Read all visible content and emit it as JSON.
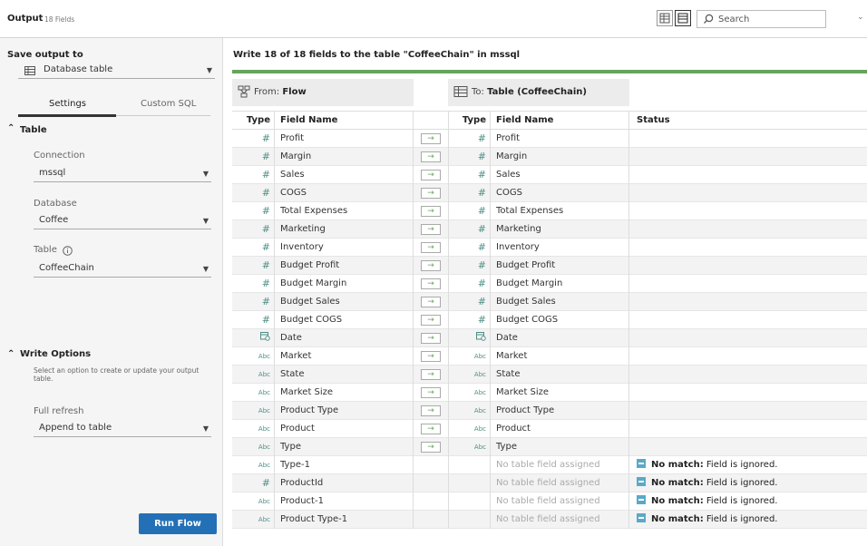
{
  "header": {
    "title": "Output",
    "field_count": "18 Fields",
    "search_placeholder": "Search"
  },
  "left": {
    "save_output_label": "Save output to",
    "save_output_value": "Database table",
    "tabs": [
      "Settings",
      "Custom SQL"
    ],
    "table_section": "Table",
    "connection_label": "Connection",
    "connection_value": "mssql",
    "database_label": "Database",
    "database_value": "Coffee",
    "table_label": "Table",
    "table_value": "CoffeeChain",
    "write_options_section": "Write Options",
    "write_options_help": "Select an option to create or update your output table.",
    "refresh_label": "Full refresh",
    "refresh_value": "Append to table",
    "run_button": "Run Flow"
  },
  "main": {
    "heading": "Write 18 of 18 fields to the table \"CoffeeChain\" in mssql",
    "from_prefix": "From: ",
    "from_name": "Flow",
    "to_prefix": "To: ",
    "to_name": "Table (CoffeeChain)",
    "columns": [
      "Type",
      "Field Name",
      "Type",
      "Field Name",
      "Status"
    ],
    "no_match_bold": "No match:",
    "no_match_text": "Field is ignored.",
    "unassigned_text": "No table field assigned",
    "rows": [
      {
        "type": "number",
        "from": "Profit",
        "to": "Profit"
      },
      {
        "type": "number",
        "from": "Margin",
        "to": "Margin"
      },
      {
        "type": "number",
        "from": "Sales",
        "to": "Sales"
      },
      {
        "type": "number",
        "from": "COGS",
        "to": "COGS"
      },
      {
        "type": "number",
        "from": "Total Expenses",
        "to": "Total Expenses"
      },
      {
        "type": "number",
        "from": "Marketing",
        "to": "Marketing"
      },
      {
        "type": "number",
        "from": "Inventory",
        "to": "Inventory"
      },
      {
        "type": "number",
        "from": "Budget Profit",
        "to": "Budget Profit"
      },
      {
        "type": "number",
        "from": "Budget Margin",
        "to": "Budget Margin"
      },
      {
        "type": "number",
        "from": "Budget Sales",
        "to": "Budget Sales"
      },
      {
        "type": "number",
        "from": "Budget COGS",
        "to": "Budget COGS"
      },
      {
        "type": "date",
        "from": "Date",
        "to": "Date"
      },
      {
        "type": "string",
        "from": "Market",
        "to": "Market"
      },
      {
        "type": "string",
        "from": "State",
        "to": "State"
      },
      {
        "type": "string",
        "from": "Market Size",
        "to": "Market Size"
      },
      {
        "type": "string",
        "from": "Product Type",
        "to": "Product Type"
      },
      {
        "type": "string",
        "from": "Product",
        "to": "Product"
      },
      {
        "type": "string",
        "from": "Type",
        "to": "Type"
      },
      {
        "type": "string",
        "from": "Type-1",
        "to": null
      },
      {
        "type": "number",
        "from": "ProductId",
        "to": null
      },
      {
        "type": "string",
        "from": "Product-1",
        "to": null
      },
      {
        "type": "string",
        "from": "Product Type-1",
        "to": null
      }
    ],
    "type_glyphs": {
      "number": "#",
      "string": "Abc",
      "date": "date-icon"
    },
    "colors": {
      "accent_green": "#66a45a",
      "button_blue": "#2470b7",
      "type_teal": "#4e8f86",
      "nomatch_blue": "#5aa9c8"
    }
  }
}
